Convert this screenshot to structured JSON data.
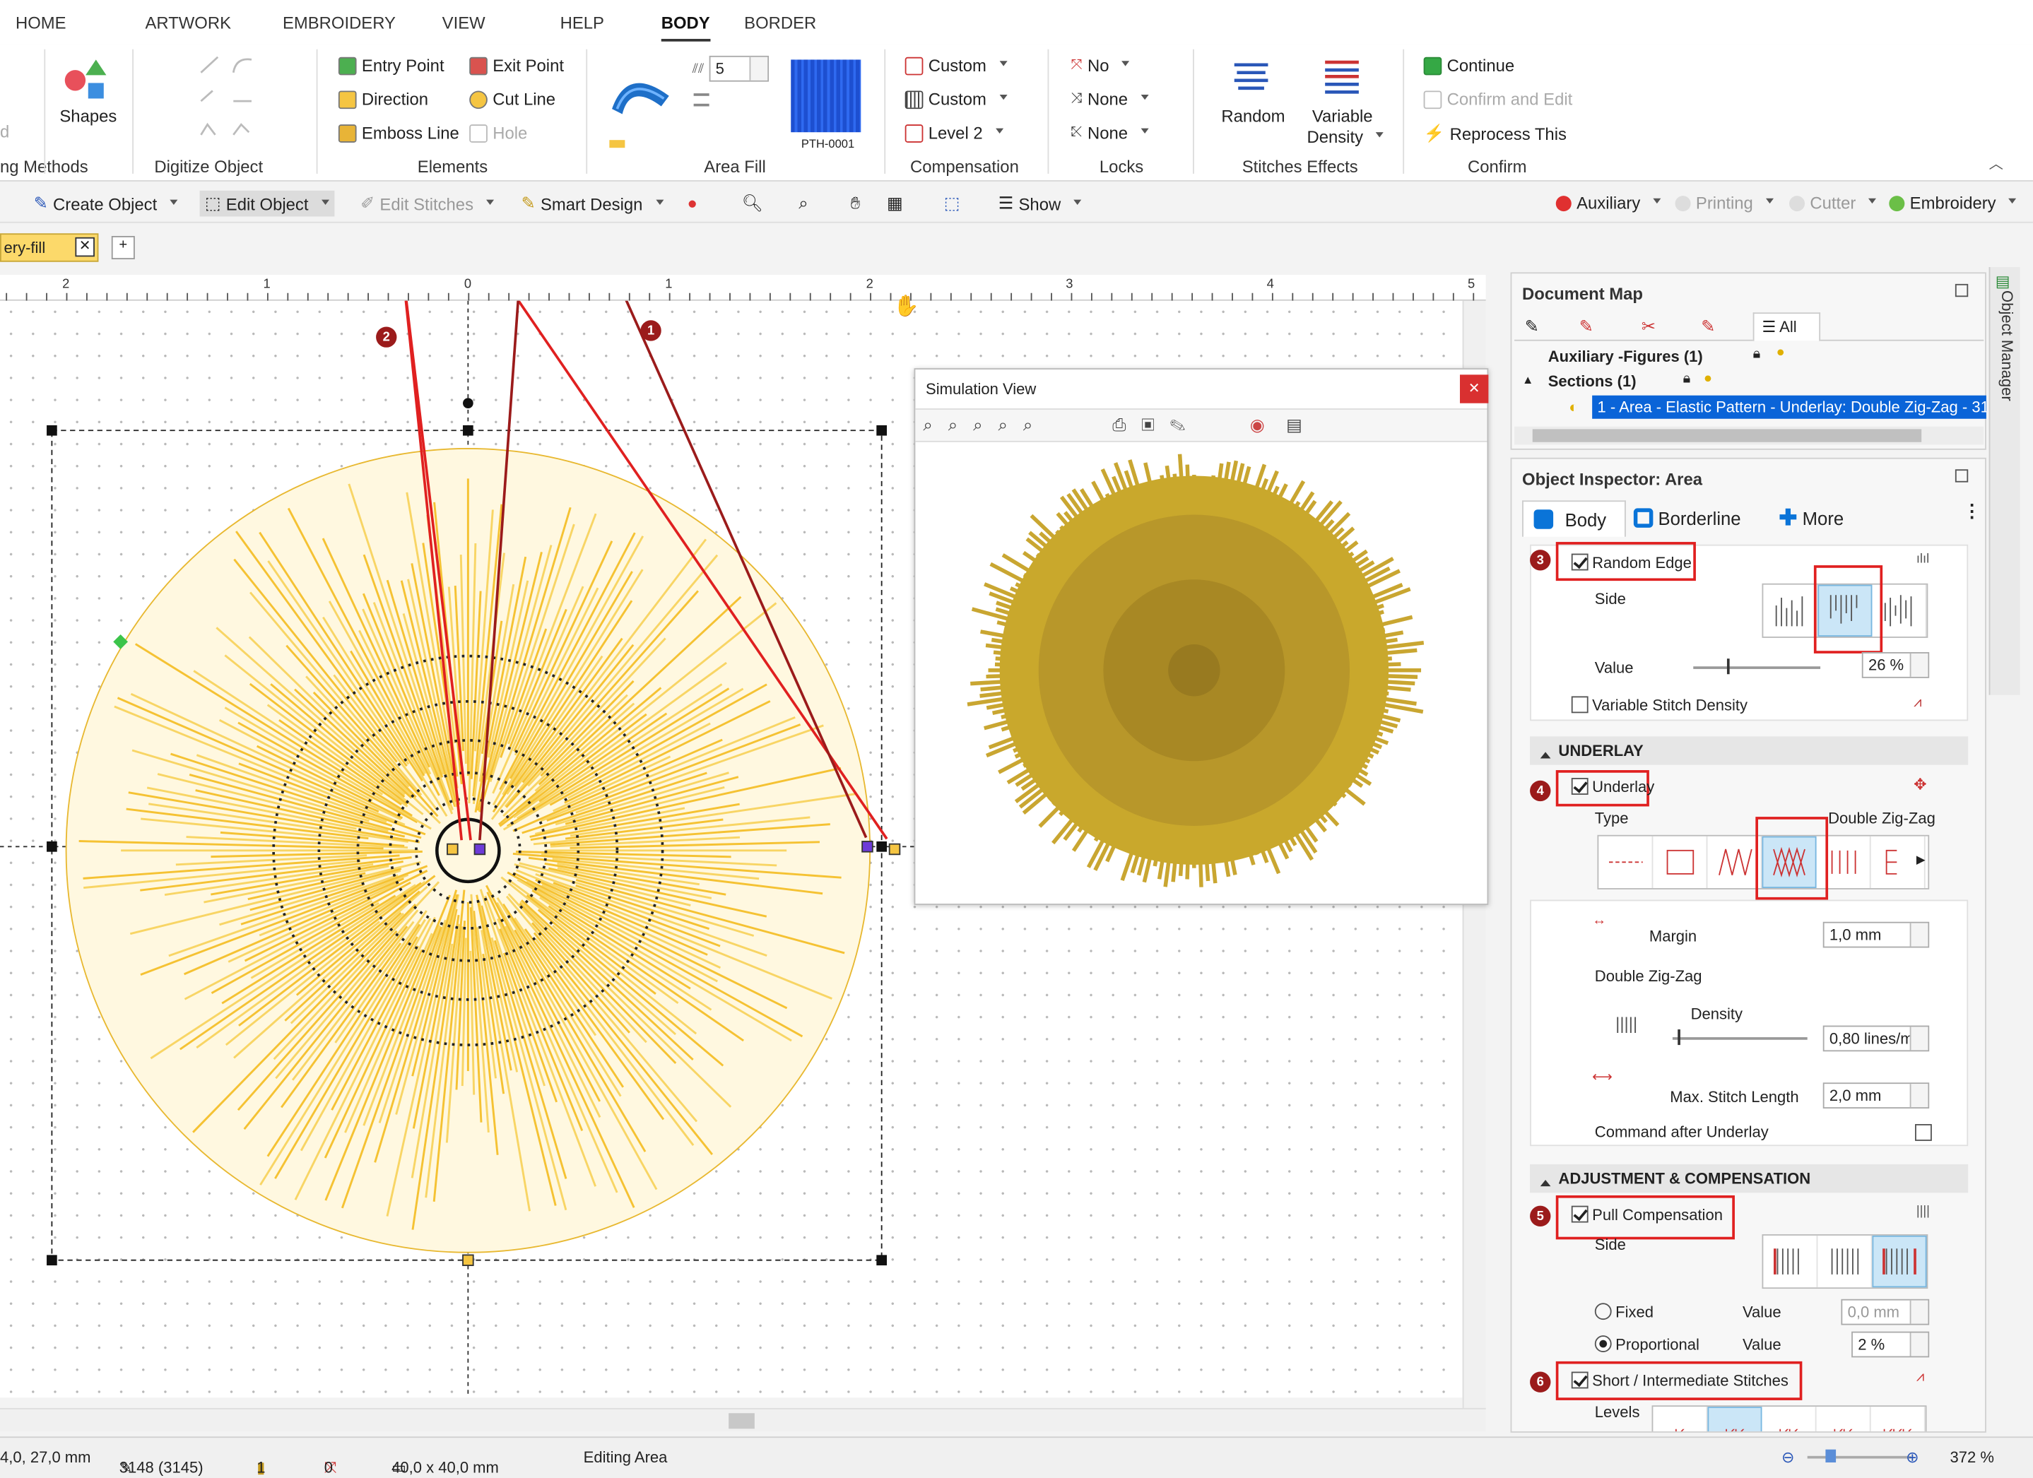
{
  "menu": {
    "tabs": [
      "HOME",
      "ARTWORK",
      "EMBROIDERY",
      "VIEW",
      "HELP",
      "BODY",
      "BORDER"
    ]
  },
  "ribbon": {
    "shapes_label": "Shapes",
    "group_methods": "ng Methods",
    "group_methods_prefix": "d",
    "group_digitize": "Digitize Object",
    "elements": {
      "entry": "Entry Point",
      "exit": "Exit Point",
      "direction": "Direction",
      "cut": "Cut Line",
      "emboss": "Emboss Line",
      "hole": "Hole",
      "label": "Elements"
    },
    "areafill": {
      "value": "5",
      "pattern_code": "PTH-0001",
      "label": "Area Fill"
    },
    "compensation": {
      "c1": "Custom",
      "c2": "Custom",
      "c3": "Level 2",
      "label": "Compensation"
    },
    "locks": {
      "l1": "No",
      "l2": "None",
      "l3": "None",
      "label": "Locks"
    },
    "effects": {
      "random": "Random",
      "variable": "Variable",
      "density": "Density",
      "label": "Stitches Effects"
    },
    "confirm": {
      "continue": "Continue",
      "confirm_edit": "Confirm and Edit",
      "reprocess": "Reprocess This",
      "label": "Confirm"
    }
  },
  "toolbar": {
    "create": "Create Object",
    "edit": "Edit Object",
    "stitches": "Edit Stitches",
    "smart": "Smart Design",
    "show": "Show",
    "auxiliary": "Auxiliary",
    "printing": "Printing",
    "cutter": "Cutter",
    "embroidery": "Embroidery"
  },
  "doc_tab": "ery-fill",
  "ruler": [
    "2",
    "1",
    "0",
    "1",
    "2",
    "3",
    "4",
    "5"
  ],
  "annotations": [
    "2",
    "1",
    "3",
    "4",
    "5",
    "6"
  ],
  "simulation": {
    "title": "Simulation View"
  },
  "document_map": {
    "title": "Document Map",
    "all": "All",
    "aux": "Auxiliary -Figures (1)",
    "sections": "Sections (1)",
    "item": "1 - Area - Elastic Pattern - Underlay: Double Zig-Zag - 31"
  },
  "inspector": {
    "title": "Object Inspector: Area",
    "tabs": [
      "Body",
      "Borderline",
      "More"
    ],
    "random_edge": "Random Edge",
    "side": "Side",
    "value": "Value",
    "value_pct": "26 %",
    "variable_density": "Variable Stitch Density",
    "underlay_section": "UNDERLAY",
    "underlay": "Underlay",
    "type": "Type",
    "type_value": "Double Zig-Zag",
    "margin": "Margin",
    "margin_value": "1,0 mm",
    "dzz": "Double Zig-Zag",
    "density": "Density",
    "density_value": "0,80 lines/m",
    "max_len": "Max. Stitch Length",
    "max_len_value": "2,0 mm",
    "cmd_after": "Command after Underlay",
    "adj_section": "ADJUSTMENT & COMPENSATION",
    "pull": "Pull Compensation",
    "side2": "Side",
    "fixed": "Fixed",
    "fixed_value_label": "Value",
    "fixed_value": "0,0 mm",
    "proportional": "Proportional",
    "prop_value_label": "Value",
    "prop_value": "2 %",
    "short": "Short / Intermediate Stitches",
    "levels": "Levels"
  },
  "object_manager": "Object Manager",
  "status": {
    "coords": "4,0, 27,0 mm",
    "stitches": "3148 (3145)",
    "s1": "1",
    "s2": "0",
    "size": "40,0 x 40,0 mm",
    "mode": "Editing Area",
    "zoom": "372 %"
  }
}
